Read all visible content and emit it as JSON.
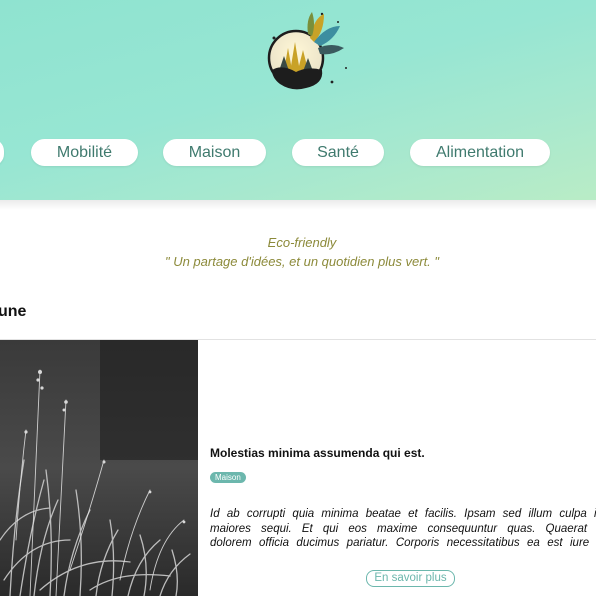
{
  "header": {
    "nav": [
      {
        "label": ""
      },
      {
        "label": "Mobilité"
      },
      {
        "label": "Maison"
      },
      {
        "label": "Santé"
      },
      {
        "label": "Alimentation"
      }
    ]
  },
  "tagline": {
    "title": "Eco-friendly",
    "quote": "\" Un partage d'idées, et un quotidien plus vert. \""
  },
  "section": {
    "title": "une"
  },
  "article": {
    "title": "Molestias minima assumenda qui est.",
    "category": "Maison",
    "excerpt_lines": [
      "Id ab corrupti quia minima beatae et facilis. Ipsam sed illum culpa iu",
      "maiores sequi. Et qui eos maxime consequuntur quas. Quaerat s",
      "dolorem officia ducimus pariatur. Corporis necessitatibus ea est iure q"
    ],
    "more_label": "En savoir plus"
  },
  "colors": {
    "header_bg": "#97e6d3",
    "nav_text": "#3f7a6e",
    "tagline": "#8c8a3a",
    "accent": "#6cb7ad"
  },
  "icons": {
    "logo": "forest-globe-logo-icon"
  }
}
